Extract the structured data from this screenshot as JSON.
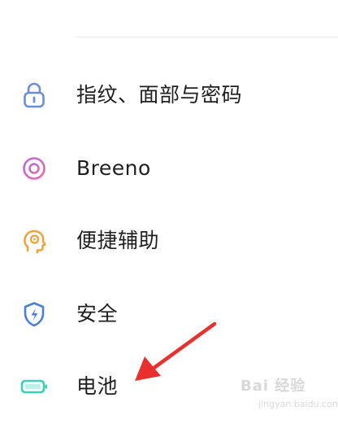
{
  "settings": {
    "items": [
      {
        "label": "指纹、面部与密码",
        "icon": "lock-icon",
        "icon_color": "#6a8fd8"
      },
      {
        "label": "Breeno",
        "icon": "breeno-ring-icon",
        "icon_color": "#c46ad6"
      },
      {
        "label": "便捷辅助",
        "icon": "head-gear-icon",
        "icon_color": "#f0a23a"
      },
      {
        "label": "安全",
        "icon": "shield-lightning-icon",
        "icon_color": "#4a7fd8"
      },
      {
        "label": "电池",
        "icon": "battery-icon",
        "icon_color": "#3ccfb4"
      }
    ]
  },
  "annotation": {
    "arrow_color": "#e8312f"
  },
  "watermark": {
    "brand": "Bai 经验",
    "sub": "jingyan.baidu.com"
  }
}
